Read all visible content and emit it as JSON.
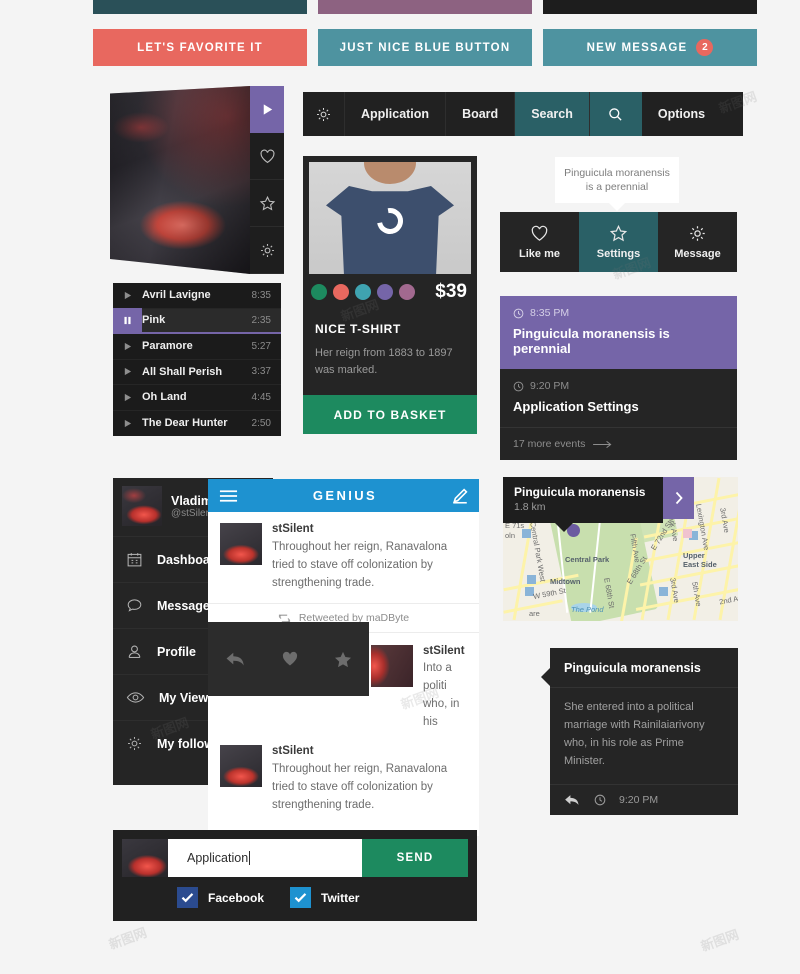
{
  "colors": {
    "teal_dark": "#2a5058",
    "purple_mauve": "#8d6281",
    "near_black": "#1d1d1d",
    "coral": "#e8685f",
    "blue_teal": "#4e93a0",
    "accent_purple": "#7565a8",
    "green": "#1d8a5f",
    "blue": "#1e92d0",
    "select_teal": "#2a6066"
  },
  "top_bars": [
    {
      "name": "teal-bar",
      "color": "#2a5058"
    },
    {
      "name": "mauve-bar",
      "color": "#8d6281"
    },
    {
      "name": "black-bar",
      "color": "#1d1d1d"
    }
  ],
  "top_buttons": [
    {
      "label": "LET'S FAVORITE IT",
      "color": "#e8685f",
      "badge": null
    },
    {
      "label": "JUST NICE BLUE BUTTON",
      "color": "#4e93a0",
      "badge": null
    },
    {
      "label": "NEW MESSAGE",
      "color": "#4e93a0",
      "badge": "2"
    }
  ],
  "media_card": {
    "buttons": [
      {
        "icon": "play-icon",
        "active": true
      },
      {
        "icon": "heart-icon",
        "active": false
      },
      {
        "icon": "star-icon",
        "active": false
      },
      {
        "icon": "gear-icon",
        "active": false
      }
    ]
  },
  "playlist": {
    "tracks": [
      {
        "name": "Avril Lavigne",
        "time": "8:35",
        "state": "paused"
      },
      {
        "name": "Pink",
        "time": "2:35",
        "state": "playing"
      },
      {
        "name": "Paramore",
        "time": "5:27",
        "state": "paused"
      },
      {
        "name": "All Shall Perish",
        "time": "3:37",
        "state": "paused"
      },
      {
        "name": "Oh Land",
        "time": "4:45",
        "state": "paused"
      },
      {
        "name": "The Dear Hunter",
        "time": "2:50",
        "state": "paused"
      }
    ]
  },
  "navbar": {
    "gear_icon": "gear-icon",
    "search_icon": "search-icon",
    "items": [
      {
        "label": "Application",
        "selected": false
      },
      {
        "label": "Board",
        "selected": false
      },
      {
        "label": "Search",
        "selected": true
      },
      {
        "label": "Options",
        "selected": false
      }
    ]
  },
  "product": {
    "title": "NICE T-SHIRT",
    "description": "Her reign from 1883 to 1897 was marked.",
    "price": "$39",
    "basket_label": "ADD TO BASKET",
    "swatches": [
      "#1d8a5f",
      "#e8685f",
      "#3fa3b0",
      "#7565a8",
      "#a2698f"
    ]
  },
  "tooltip": {
    "line1": "Pinguicula moranensis",
    "line2": "is a perennial"
  },
  "icon_row": [
    {
      "label": "Like me",
      "icon": "heart-icon",
      "selected": false
    },
    {
      "label": "Settings",
      "icon": "star-icon",
      "selected": true
    },
    {
      "label": "Message",
      "icon": "gear-icon",
      "selected": false
    }
  ],
  "events": {
    "highlight": {
      "time": "8:35 PM",
      "title": "Pinguicula moranensis is perennial"
    },
    "second": {
      "time": "9:20 PM",
      "title": "Application Settings"
    },
    "more_label": "17 more events"
  },
  "sidebar": {
    "user": {
      "name": "Vladimir",
      "handle": "@stSilent"
    },
    "items": [
      {
        "label": "Dashboard",
        "icon": "calendar-icon"
      },
      {
        "label": "Messages",
        "icon": "chat-bubble-icon"
      },
      {
        "label": "Profile",
        "icon": "user-icon"
      },
      {
        "label": "My Views",
        "icon": "eye-icon"
      },
      {
        "label": "My followers",
        "icon": "gear-icon"
      }
    ]
  },
  "genius": {
    "title": "GENIUS",
    "menu_icon": "hamburger-icon",
    "compose_icon": "compose-icon",
    "posts": [
      {
        "user": "stSilent",
        "text": "Throughout her reign, Ranavalona tried to stave off colonization by strengthening trade."
      },
      {
        "user": "stSilent",
        "text": "Throughout her reign, Ranavalona tried to stave off colonization by strengthening trade."
      }
    ],
    "retweet": {
      "label": "Retweeted by maDByte",
      "icon": "retweet-icon"
    },
    "side_post": {
      "user": "stSilent",
      "line1": "Into a politi",
      "line2": "who, in his"
    },
    "actions": [
      {
        "icon": "reply-icon"
      },
      {
        "icon": "heart-icon"
      },
      {
        "icon": "star-icon"
      }
    ]
  },
  "map": {
    "tooltip_title": "Pinguicula moranensis",
    "tooltip_sub": "1.8 km",
    "go_icon": "chevron-right-icon",
    "labels": [
      "Central Park",
      "Midtown",
      "Upper East Side",
      "The Pond",
      "Central Park West",
      "Fifth Ave",
      "Park Ave",
      "Lexington Ave",
      "3rd Ave",
      "W 59th St",
      "E 72nd St",
      "E 68th St",
      "5th Ave",
      "2nd Ave",
      "E 71s",
      "oln",
      "are",
      "W 5",
      "Co",
      "B",
      "3rd Ave"
    ]
  },
  "chat": {
    "title": "Pinguicula moranensis",
    "body": "She entered into a political marriage with Rainilaiarivony who, in his role as Prime Minister.",
    "time": "9:20 PM",
    "reply_icon": "reply-icon",
    "clock_icon": "clock-icon"
  },
  "compose": {
    "input_value": "Application",
    "send_label": "SEND",
    "checkboxes": [
      {
        "label": "Facebook",
        "checked": true,
        "color": "#2b4b8f"
      },
      {
        "label": "Twitter",
        "checked": true,
        "color": "#1e92d0"
      }
    ]
  },
  "watermarks": [
    "新图网",
    "新图网",
    "新图网",
    "新图网",
    "新图网",
    "新图网",
    "新图网"
  ]
}
